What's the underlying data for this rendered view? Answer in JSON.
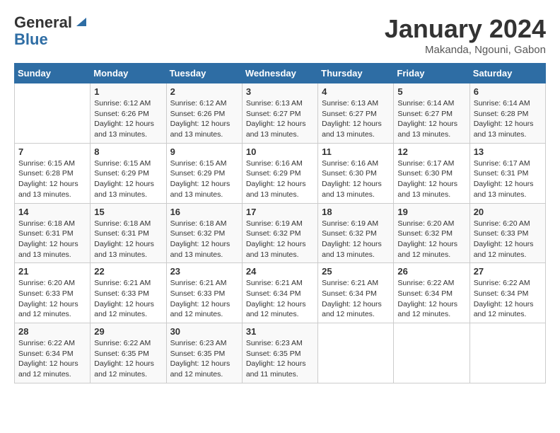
{
  "logo": {
    "line1": "General",
    "line2": "Blue"
  },
  "title": "January 2024",
  "location": "Makanda, Ngouni, Gabon",
  "days_of_week": [
    "Sunday",
    "Monday",
    "Tuesday",
    "Wednesday",
    "Thursday",
    "Friday",
    "Saturday"
  ],
  "weeks": [
    [
      {
        "num": "",
        "info": ""
      },
      {
        "num": "1",
        "info": "Sunrise: 6:12 AM\nSunset: 6:26 PM\nDaylight: 12 hours\nand 13 minutes."
      },
      {
        "num": "2",
        "info": "Sunrise: 6:12 AM\nSunset: 6:26 PM\nDaylight: 12 hours\nand 13 minutes."
      },
      {
        "num": "3",
        "info": "Sunrise: 6:13 AM\nSunset: 6:27 PM\nDaylight: 12 hours\nand 13 minutes."
      },
      {
        "num": "4",
        "info": "Sunrise: 6:13 AM\nSunset: 6:27 PM\nDaylight: 12 hours\nand 13 minutes."
      },
      {
        "num": "5",
        "info": "Sunrise: 6:14 AM\nSunset: 6:27 PM\nDaylight: 12 hours\nand 13 minutes."
      },
      {
        "num": "6",
        "info": "Sunrise: 6:14 AM\nSunset: 6:28 PM\nDaylight: 12 hours\nand 13 minutes."
      }
    ],
    [
      {
        "num": "7",
        "info": "Sunrise: 6:15 AM\nSunset: 6:28 PM\nDaylight: 12 hours\nand 13 minutes."
      },
      {
        "num": "8",
        "info": "Sunrise: 6:15 AM\nSunset: 6:29 PM\nDaylight: 12 hours\nand 13 minutes."
      },
      {
        "num": "9",
        "info": "Sunrise: 6:15 AM\nSunset: 6:29 PM\nDaylight: 12 hours\nand 13 minutes."
      },
      {
        "num": "10",
        "info": "Sunrise: 6:16 AM\nSunset: 6:29 PM\nDaylight: 12 hours\nand 13 minutes."
      },
      {
        "num": "11",
        "info": "Sunrise: 6:16 AM\nSunset: 6:30 PM\nDaylight: 12 hours\nand 13 minutes."
      },
      {
        "num": "12",
        "info": "Sunrise: 6:17 AM\nSunset: 6:30 PM\nDaylight: 12 hours\nand 13 minutes."
      },
      {
        "num": "13",
        "info": "Sunrise: 6:17 AM\nSunset: 6:31 PM\nDaylight: 12 hours\nand 13 minutes."
      }
    ],
    [
      {
        "num": "14",
        "info": "Sunrise: 6:18 AM\nSunset: 6:31 PM\nDaylight: 12 hours\nand 13 minutes."
      },
      {
        "num": "15",
        "info": "Sunrise: 6:18 AM\nSunset: 6:31 PM\nDaylight: 12 hours\nand 13 minutes."
      },
      {
        "num": "16",
        "info": "Sunrise: 6:18 AM\nSunset: 6:32 PM\nDaylight: 12 hours\nand 13 minutes."
      },
      {
        "num": "17",
        "info": "Sunrise: 6:19 AM\nSunset: 6:32 PM\nDaylight: 12 hours\nand 13 minutes."
      },
      {
        "num": "18",
        "info": "Sunrise: 6:19 AM\nSunset: 6:32 PM\nDaylight: 12 hours\nand 13 minutes."
      },
      {
        "num": "19",
        "info": "Sunrise: 6:20 AM\nSunset: 6:32 PM\nDaylight: 12 hours\nand 12 minutes."
      },
      {
        "num": "20",
        "info": "Sunrise: 6:20 AM\nSunset: 6:33 PM\nDaylight: 12 hours\nand 12 minutes."
      }
    ],
    [
      {
        "num": "21",
        "info": "Sunrise: 6:20 AM\nSunset: 6:33 PM\nDaylight: 12 hours\nand 12 minutes."
      },
      {
        "num": "22",
        "info": "Sunrise: 6:21 AM\nSunset: 6:33 PM\nDaylight: 12 hours\nand 12 minutes."
      },
      {
        "num": "23",
        "info": "Sunrise: 6:21 AM\nSunset: 6:33 PM\nDaylight: 12 hours\nand 12 minutes."
      },
      {
        "num": "24",
        "info": "Sunrise: 6:21 AM\nSunset: 6:34 PM\nDaylight: 12 hours\nand 12 minutes."
      },
      {
        "num": "25",
        "info": "Sunrise: 6:21 AM\nSunset: 6:34 PM\nDaylight: 12 hours\nand 12 minutes."
      },
      {
        "num": "26",
        "info": "Sunrise: 6:22 AM\nSunset: 6:34 PM\nDaylight: 12 hours\nand 12 minutes."
      },
      {
        "num": "27",
        "info": "Sunrise: 6:22 AM\nSunset: 6:34 PM\nDaylight: 12 hours\nand 12 minutes."
      }
    ],
    [
      {
        "num": "28",
        "info": "Sunrise: 6:22 AM\nSunset: 6:34 PM\nDaylight: 12 hours\nand 12 minutes."
      },
      {
        "num": "29",
        "info": "Sunrise: 6:22 AM\nSunset: 6:35 PM\nDaylight: 12 hours\nand 12 minutes."
      },
      {
        "num": "30",
        "info": "Sunrise: 6:23 AM\nSunset: 6:35 PM\nDaylight: 12 hours\nand 12 minutes."
      },
      {
        "num": "31",
        "info": "Sunrise: 6:23 AM\nSunset: 6:35 PM\nDaylight: 12 hours\nand 11 minutes."
      },
      {
        "num": "",
        "info": ""
      },
      {
        "num": "",
        "info": ""
      },
      {
        "num": "",
        "info": ""
      }
    ]
  ]
}
